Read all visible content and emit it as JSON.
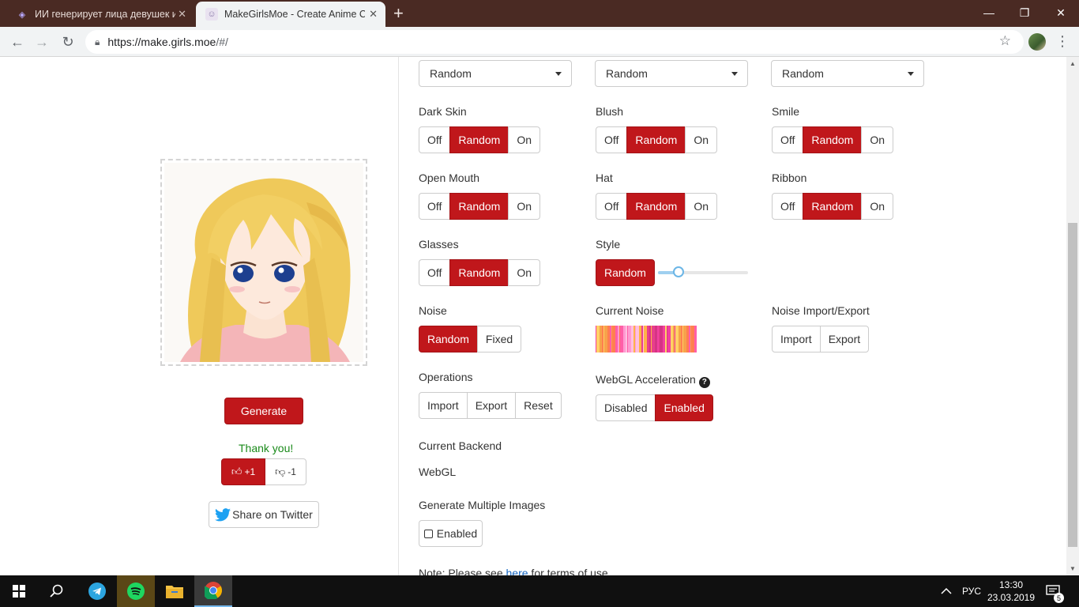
{
  "browser": {
    "tabs": [
      {
        "title": "ИИ генерирует лица девушек и",
        "active": false
      },
      {
        "title": "MakeGirlsMoe - Create Anime Ch",
        "active": true
      }
    ],
    "new_tab": "+",
    "url_host": "https://make.girls.moe",
    "url_path": "/#/",
    "window": {
      "minimize": "—",
      "maximize": "❐",
      "close": "✕"
    }
  },
  "left": {
    "generate_label": "Generate",
    "thanks": "Thank you!",
    "vote_up": "+1",
    "vote_down": "-1",
    "twitter_label": "Share on Twitter"
  },
  "options": {
    "selects": [
      "Random",
      "Random",
      "Random"
    ],
    "toggles": {
      "off": "Off",
      "random": "Random",
      "on": "On"
    },
    "dark_skin": "Dark Skin",
    "blush": "Blush",
    "smile": "Smile",
    "open_mouth": "Open Mouth",
    "hat": "Hat",
    "ribbon": "Ribbon",
    "glasses": "Glasses",
    "style": "Style",
    "style_button": "Random",
    "style_slider_value": 0.23,
    "noise": "Noise",
    "noise_random": "Random",
    "noise_fixed": "Fixed",
    "current_noise": "Current Noise",
    "noise_io": "Noise Import/Export",
    "import": "Import",
    "export": "Export",
    "operations": "Operations",
    "op_import": "Import",
    "op_export": "Export",
    "op_reset": "Reset",
    "webgl_label": "WebGL Acceleration",
    "webgl_disabled": "Disabled",
    "webgl_enabled": "Enabled",
    "backend_label": "Current Backend",
    "backend_value": "WebGL",
    "multi_label": "Generate Multiple Images",
    "multi_enabled": "Enabled",
    "note_prefix": "Note: Please see ",
    "note_link": "here",
    "note_suffix": " for terms of use."
  },
  "taskbar": {
    "lang": "РУС",
    "time": "13:30",
    "date": "23.03.2019",
    "notifications": "5"
  },
  "colors": {
    "accent": "#c0171b",
    "tabbar": "#4a2a23",
    "success": "#1a8a1a"
  }
}
